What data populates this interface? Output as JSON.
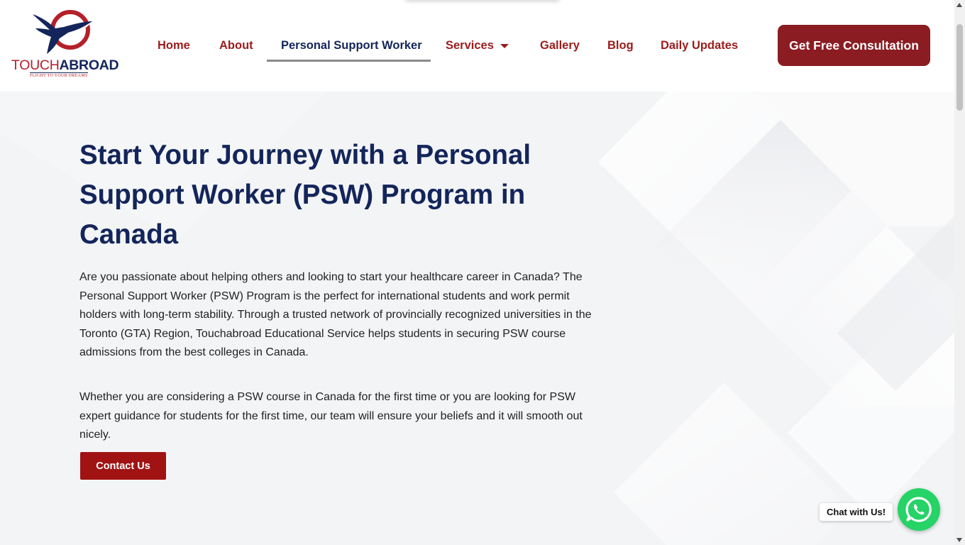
{
  "brand": {
    "name_part1": "TOUCH",
    "name_part2": "ABROAD",
    "tagline": "FLIGHT TO YOUR DREAMS"
  },
  "nav": {
    "items": [
      {
        "label": "Home"
      },
      {
        "label": "About"
      },
      {
        "label": "Personal Support Worker",
        "active": true
      },
      {
        "label": "Services",
        "has_dropdown": true
      },
      {
        "label": "Gallery"
      },
      {
        "label": "Blog"
      },
      {
        "label": "Daily Updates"
      }
    ],
    "cta_label": "Get Free Consultation"
  },
  "hero": {
    "title": "Start Your Journey with a Personal Support Worker (PSW) Program in Canada",
    "paragraph1": "Are you passionate about helping others and looking to start your healthcare career in Canada? The Personal Support Worker (PSW) Program is the perfect for international students and work permit holders with long-term stability. Through a trusted network of provincially recognized universities in the Toronto (GTA) Region, Touchabroad Educational Service helps students in securing PSW course admissions from the best colleges in Canada.",
    "paragraph2": "Whether you are considering a PSW course in Canada for the first time or you are looking for PSW expert guidance for students for the first time, our team will ensure your beliefs and it will smooth out nicely.",
    "button_label": "Contact Us"
  },
  "chat": {
    "label": "Chat with Us!",
    "icon": "whatsapp-icon"
  },
  "colors": {
    "brand_red": "#8a1c22",
    "nav_red": "#9b1c1c",
    "navy": "#13255a",
    "contact_red": "#a11313",
    "whatsapp_green": "#25d366",
    "hero_bg": "#f3f4f6"
  }
}
